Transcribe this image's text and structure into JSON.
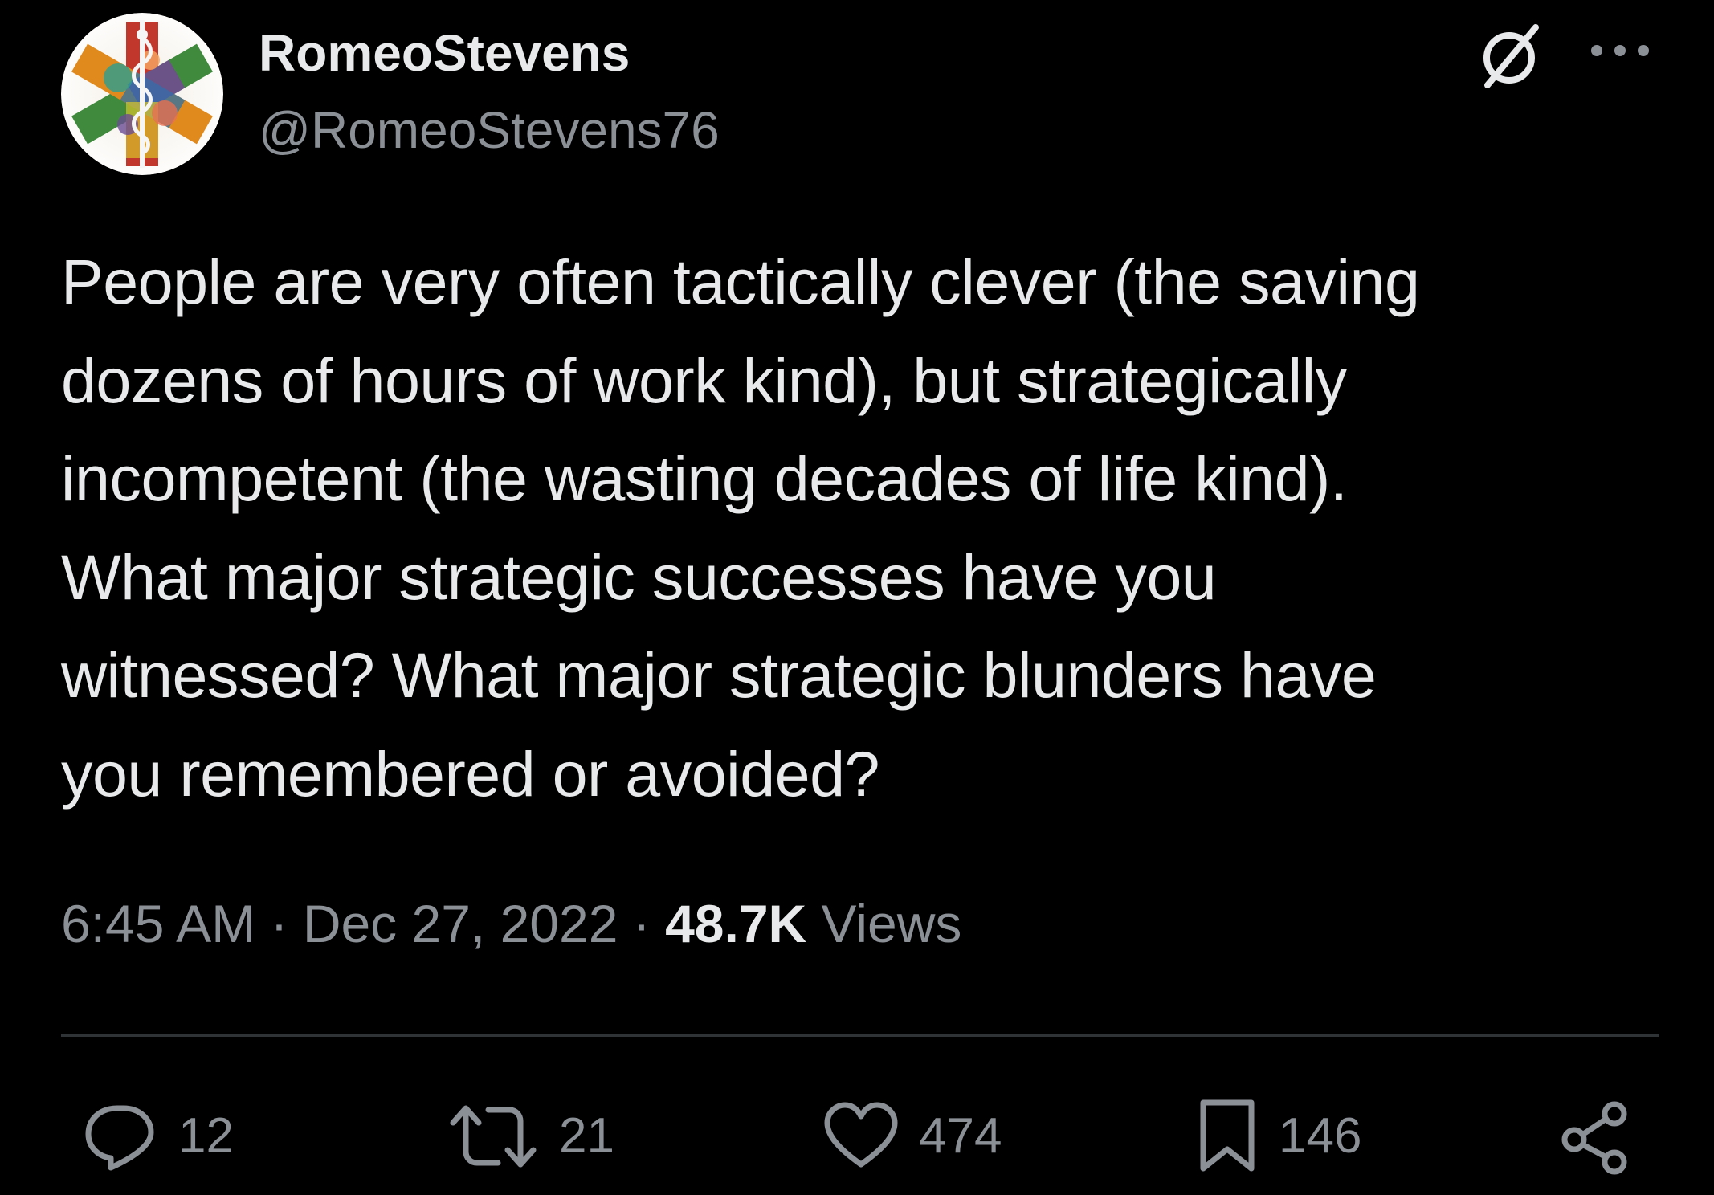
{
  "author": {
    "display_name": "RomeoStevens",
    "handle": "@RomeoStevens76",
    "avatar_icon": "caduceus-star-of-life-avatar",
    "badge_icon": "empty-set-icon"
  },
  "tweet": {
    "text": "People are very often tactically clever (the saving\ndozens of hours of work kind), but strategically\nincompetent (the wasting decades of life kind).\nWhat major strategic successes have you\nwitnessed? What major strategic blunders have\nyou remembered or avoided?"
  },
  "meta": {
    "time": "6:45 AM",
    "separator": " · ",
    "date": "Dec 27, 2022",
    "views_count": "48.7K",
    "views_label": " Views"
  },
  "actions": {
    "reply_count": "12",
    "retweet_count": "21",
    "like_count": "474",
    "bookmark_count": "146"
  },
  "colors": {
    "background": "#000000",
    "primary_text": "#e7e9ea",
    "secondary_text": "#8b9097",
    "divider": "#2f3336"
  }
}
